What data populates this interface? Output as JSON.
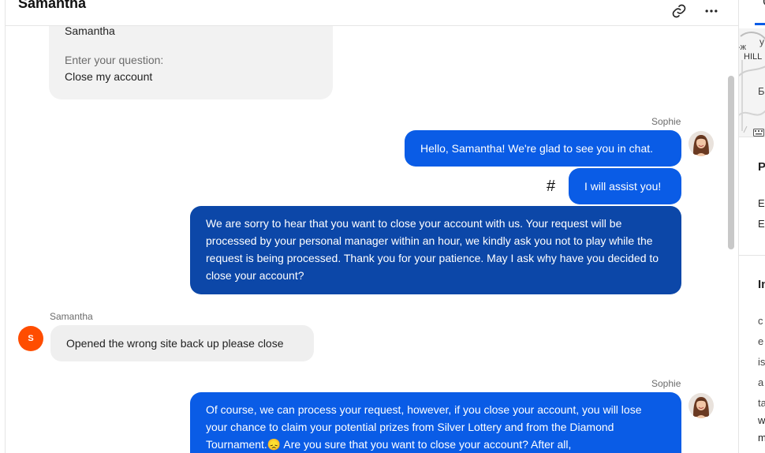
{
  "header": {
    "title": "Samantha",
    "link_icon": "link-icon",
    "more_icon": "more-horizontal-icon"
  },
  "form": {
    "name_value": "Samantha",
    "question_label": "Enter your question:",
    "question_value": "Close my account"
  },
  "messages": [
    {
      "sender": "Sophie",
      "text": "Hello, Samantha! We're glad to see you in chat."
    },
    {
      "text": "I will assist you!"
    },
    {
      "text": "We are sorry to hear that you want to close your account with us. Your request will be processed by your personal manager within an hour, we kindly ask you not to play while the request is being processed. Thank you for your patience. May I ask why have you decided to close your account?"
    },
    {
      "sender": "Samantha",
      "text": "Opened the wrong site back up please close"
    },
    {
      "sender": "Sophie",
      "text_before_emoji": "Of course, we can process your request, however, if you close your account, you will lose your chance to claim your potential prizes from Silver Lottery and from the Diamond Tournament.",
      "emoji": "😞",
      "text_after_emoji": " Are you sure that you want to close your account? After all,"
    }
  ],
  "hash_symbol": "#",
  "user_avatar_initial": "S",
  "colors": {
    "agent_bubble": "#0a5ce6",
    "agent_bubble_dark": "#0c47a8",
    "user_bubble": "#efefef",
    "user_avatar": "#ff4d00"
  },
  "right_panel": {
    "tab_letter": "C",
    "map_fragments": [
      "у",
      "-ж",
      "HILL",
      "Б"
    ],
    "keyboard_icon": "keyboard-icon",
    "section_1_initial": "P",
    "section_1_lines": [
      "E",
      "E"
    ],
    "section_2_initial": "In",
    "section_2_lines": [
      "c",
      "e",
      "is",
      "a",
      "ta",
      "w",
      "m"
    ]
  }
}
